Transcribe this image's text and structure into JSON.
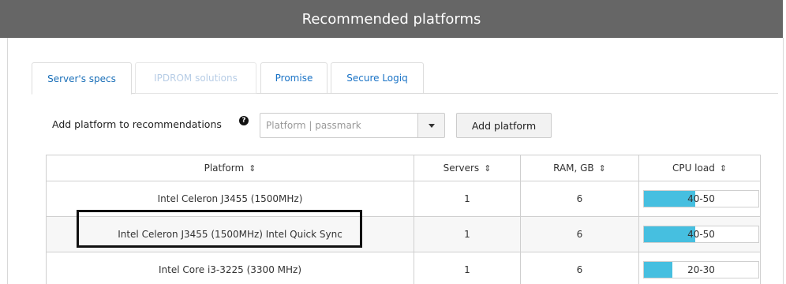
{
  "title": "Recommended platforms",
  "tabs": [
    {
      "label": "Server's specs",
      "state": "active"
    },
    {
      "label": "IPDROM solutions",
      "state": "disabled"
    },
    {
      "label": "Promise",
      "state": "normal"
    },
    {
      "label": "Secure Logiq",
      "state": "normal"
    }
  ],
  "form": {
    "label": "Add platform to recommendations",
    "help_icon": "question-circle-icon",
    "help_glyph": "?",
    "platform_input": {
      "value": "",
      "placeholder": "Platform | passmark"
    },
    "dropdown_icon": "caret-down-icon",
    "add_button_label": "Add platform"
  },
  "table": {
    "columns": [
      {
        "label": "Platform",
        "sort_icon": "sort-icon",
        "sort_glyph": "⇕"
      },
      {
        "label": "Servers",
        "sort_icon": "sort-icon",
        "sort_glyph": "⇕"
      },
      {
        "label": "RAM, GB",
        "sort_icon": "sort-icon",
        "sort_glyph": "⇕"
      },
      {
        "label": "CPU load",
        "sort_icon": "sort-icon",
        "sort_glyph": "⇕"
      }
    ],
    "rows": [
      {
        "platform": "Intel Celeron J3455 (1500MHz)",
        "servers": "1",
        "ram": "6",
        "cpu_load": "40-50",
        "cpu_fill_percent": 45
      },
      {
        "platform": "Intel Celeron J3455 (1500MHz) Intel Quick Sync",
        "servers": "1",
        "ram": "6",
        "cpu_load": "40-50",
        "cpu_fill_percent": 45,
        "highlighted": true
      },
      {
        "platform": "Intel Core i3-3225 (3300 MHz)",
        "servers": "1",
        "ram": "6",
        "cpu_load": "20-30",
        "cpu_fill_percent": 25
      }
    ]
  },
  "colors": {
    "title_bar": "#666666",
    "tab_link": "#1a73c6",
    "tab_disabled": "#b7cde6",
    "cpu_fill": "#46bfe0",
    "highlight_border": "#111111"
  }
}
